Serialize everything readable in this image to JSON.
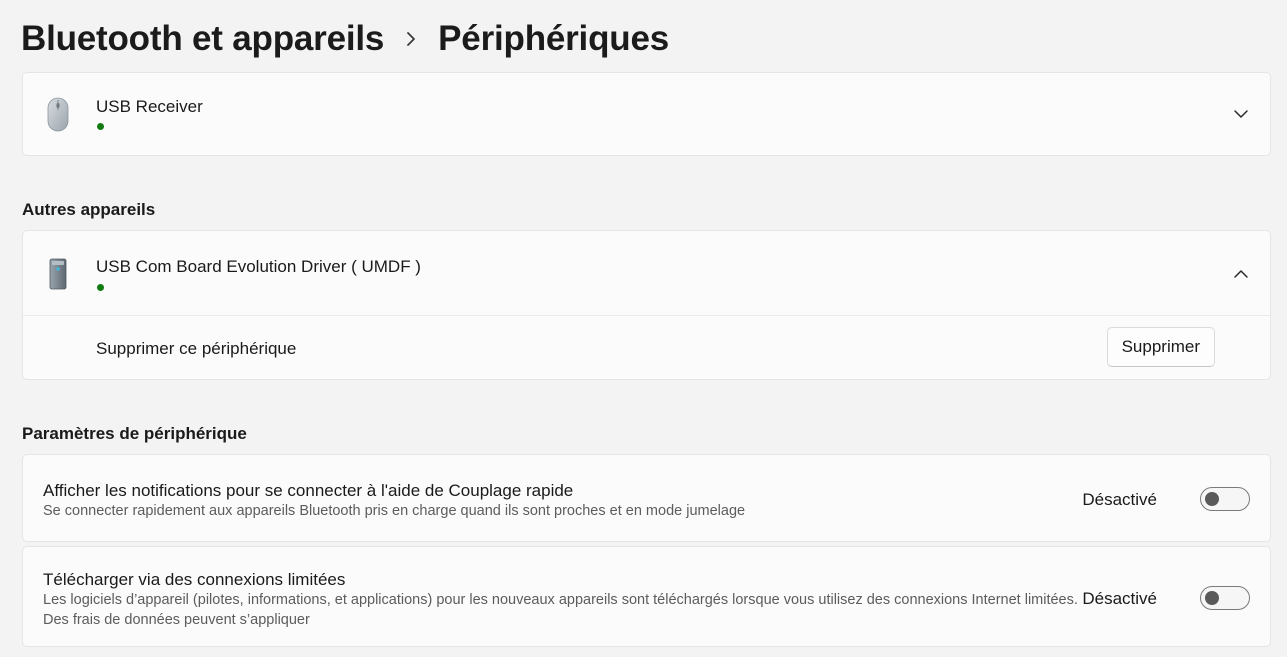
{
  "header": {
    "breadcrumb_parent": "Bluetooth et appareils",
    "breadcrumb_current": "Périphériques",
    "separator_icon": "chevron-right-icon"
  },
  "devices_top": [
    {
      "name": "USB Receiver",
      "icon": "mouse-icon",
      "status_color": "#107c10",
      "expanded": false
    }
  ],
  "other_devices": {
    "title": "Autres appareils",
    "device": {
      "name": "USB Com Board Evolution Driver ( UMDF )",
      "icon": "pc-tower-icon",
      "status_color": "#107c10",
      "expanded": true
    },
    "remove_label": "Supprimer ce périphérique",
    "remove_button": "Supprimer"
  },
  "device_settings": {
    "title": "Paramètres de périphérique",
    "items": [
      {
        "title": "Afficher les notifications pour se connecter à l'aide de Couplage rapide",
        "description": "Se connecter rapidement aux appareils Bluetooth pris en charge quand ils sont proches et en mode jumelage",
        "state_label": "Désactivé",
        "on": false
      },
      {
        "title": "Télécharger via des connexions limitées",
        "description": "Les logiciels d’appareil (pilotes, informations, et applications) pour les nouveaux appareils sont téléchargés lorsque vous utilisez des connexions Internet limitées. Des frais de données peuvent s’appliquer",
        "state_label": "Désactivé",
        "on": false
      }
    ]
  }
}
